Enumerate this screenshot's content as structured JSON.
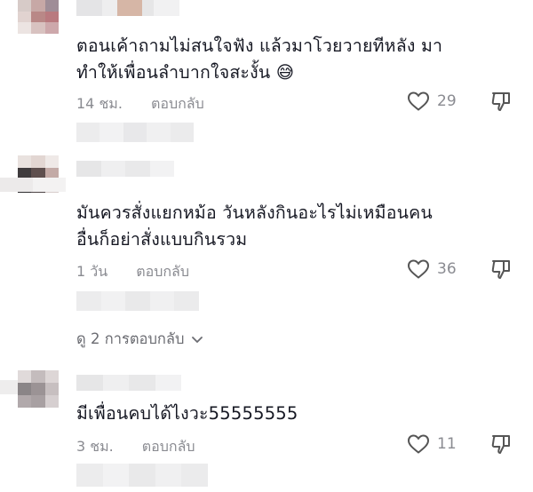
{
  "comments": [
    {
      "text": "ตอนเค้าถามไม่สนใจฟัง แล้วมาโวยวายทีหลัง มา\nทำให้เพื่อนลำบากใจสะงั้น 😅",
      "time": "14 ชม.",
      "reply_label": "ตอบกลับ",
      "likes": "29"
    },
    {
      "text": "มันควรสั่งแยกหม้อ วันหลังกินอะไรไม่เหมือนคน\nอื่นก็อย่าสั่งแบบกินรวม",
      "time": "1 วัน",
      "reply_label": "ตอบกลับ",
      "likes": "36"
    },
    {
      "text": "มีเพื่อนคบได้ไงวะ55555555",
      "time": "3 ชม.",
      "reply_label": "ตอบกลับ",
      "likes": "11"
    }
  ],
  "view_replies": {
    "label": "ดู 2 การตอบกลับ",
    "icon": "chevron-down-icon"
  },
  "colors": {
    "text": "#161823",
    "meta": "#8a8b91",
    "icon": "#555555"
  },
  "icons": [
    "heart-icon",
    "thumbs-down-icon",
    "chevron-down-icon"
  ]
}
